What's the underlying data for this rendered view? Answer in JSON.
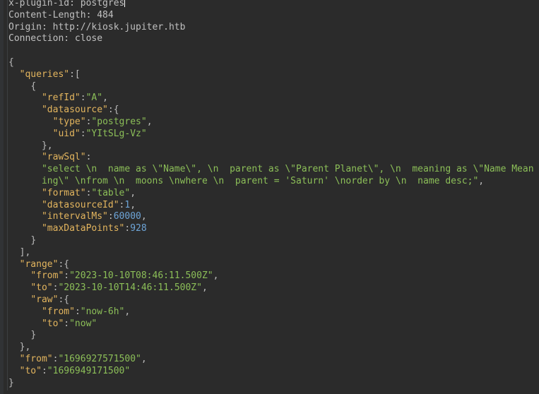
{
  "colors": {
    "background": "#2b2b2b",
    "key": "#e3b55e",
    "string": "#8cbf58",
    "number": "#6ea5d8",
    "text": "#bbbbbb"
  },
  "lines": [
    {
      "indent": 0,
      "tokens": [
        [
          "x-plugin-id: postgres",
          "hdr"
        ]
      ],
      "cursor": true
    },
    {
      "indent": 0,
      "tokens": [
        [
          "Content-Length: 484",
          "hdr"
        ]
      ]
    },
    {
      "indent": 0,
      "tokens": [
        [
          "Origin: http://kiosk.jupiter.htb",
          "hdr"
        ]
      ]
    },
    {
      "indent": 0,
      "tokens": [
        [
          "Connection: close",
          "hdr"
        ]
      ]
    },
    {
      "indent": 0,
      "tokens": []
    },
    {
      "indent": 0,
      "tokens": [
        [
          "{",
          "punc"
        ]
      ]
    },
    {
      "indent": 2,
      "tokens": [
        [
          "\"queries\"",
          "key"
        ],
        [
          ":[",
          "punc"
        ]
      ]
    },
    {
      "indent": 4,
      "tokens": [
        [
          "{",
          "punc"
        ]
      ]
    },
    {
      "indent": 6,
      "tokens": [
        [
          "\"refId\"",
          "key"
        ],
        [
          ":",
          "punc"
        ],
        [
          "\"A\"",
          "str"
        ],
        [
          ",",
          "punc"
        ]
      ]
    },
    {
      "indent": 6,
      "tokens": [
        [
          "\"datasource\"",
          "key"
        ],
        [
          ":{",
          "punc"
        ]
      ]
    },
    {
      "indent": 8,
      "tokens": [
        [
          "\"type\"",
          "key"
        ],
        [
          ":",
          "punc"
        ],
        [
          "\"postgres\"",
          "str"
        ],
        [
          ",",
          "punc"
        ]
      ]
    },
    {
      "indent": 8,
      "tokens": [
        [
          "\"uid\"",
          "key"
        ],
        [
          ":",
          "punc"
        ],
        [
          "\"YItSLg-Vz\"",
          "str"
        ]
      ]
    },
    {
      "indent": 6,
      "tokens": [
        [
          "},",
          "punc"
        ]
      ]
    },
    {
      "indent": 6,
      "tokens": [
        [
          "\"rawSql\"",
          "key"
        ],
        [
          ":",
          "punc"
        ]
      ]
    },
    {
      "indent": 6,
      "tokens": [
        [
          "\"select \\n  name as \\\"Name\\\", \\n  parent as \\\"Parent Planet\\\", \\n  meaning as \\\"Name Meaning\\\" \\nfrom \\n  moons \\nwhere \\n  parent = 'Saturn' \\norder by \\n  name desc;\"",
          "str"
        ],
        [
          ",",
          "punc"
        ]
      ]
    },
    {
      "indent": 6,
      "tokens": [
        [
          "\"format\"",
          "key"
        ],
        [
          ":",
          "punc"
        ],
        [
          "\"table\"",
          "str"
        ],
        [
          ",",
          "punc"
        ]
      ]
    },
    {
      "indent": 6,
      "tokens": [
        [
          "\"datasourceId\"",
          "key"
        ],
        [
          ":",
          "punc"
        ],
        [
          "1",
          "num"
        ],
        [
          ",",
          "punc"
        ]
      ]
    },
    {
      "indent": 6,
      "tokens": [
        [
          "\"intervalMs\"",
          "key"
        ],
        [
          ":",
          "punc"
        ],
        [
          "60000",
          "num"
        ],
        [
          ",",
          "punc"
        ]
      ]
    },
    {
      "indent": 6,
      "tokens": [
        [
          "\"maxDataPoints\"",
          "key"
        ],
        [
          ":",
          "punc"
        ],
        [
          "928",
          "num"
        ]
      ]
    },
    {
      "indent": 4,
      "tokens": [
        [
          "}",
          "punc"
        ]
      ]
    },
    {
      "indent": 2,
      "tokens": [
        [
          "],",
          "punc"
        ]
      ]
    },
    {
      "indent": 2,
      "tokens": [
        [
          "\"range\"",
          "key"
        ],
        [
          ":{",
          "punc"
        ]
      ]
    },
    {
      "indent": 4,
      "tokens": [
        [
          "\"from\"",
          "key"
        ],
        [
          ":",
          "punc"
        ],
        [
          "\"2023-10-10T08:46:11.500Z\"",
          "str"
        ],
        [
          ",",
          "punc"
        ]
      ]
    },
    {
      "indent": 4,
      "tokens": [
        [
          "\"to\"",
          "key"
        ],
        [
          ":",
          "punc"
        ],
        [
          "\"2023-10-10T14:46:11.500Z\"",
          "str"
        ],
        [
          ",",
          "punc"
        ]
      ]
    },
    {
      "indent": 4,
      "tokens": [
        [
          "\"raw\"",
          "key"
        ],
        [
          ":{",
          "punc"
        ]
      ]
    },
    {
      "indent": 6,
      "tokens": [
        [
          "\"from\"",
          "key"
        ],
        [
          ":",
          "punc"
        ],
        [
          "\"now-6h\"",
          "str"
        ],
        [
          ",",
          "punc"
        ]
      ]
    },
    {
      "indent": 6,
      "tokens": [
        [
          "\"to\"",
          "key"
        ],
        [
          ":",
          "punc"
        ],
        [
          "\"now\"",
          "str"
        ]
      ]
    },
    {
      "indent": 4,
      "tokens": [
        [
          "}",
          "punc"
        ]
      ]
    },
    {
      "indent": 2,
      "tokens": [
        [
          "},",
          "punc"
        ]
      ]
    },
    {
      "indent": 2,
      "tokens": [
        [
          "\"from\"",
          "key"
        ],
        [
          ":",
          "punc"
        ],
        [
          "\"1696927571500\"",
          "str"
        ],
        [
          ",",
          "punc"
        ]
      ]
    },
    {
      "indent": 2,
      "tokens": [
        [
          "\"to\"",
          "key"
        ],
        [
          ":",
          "punc"
        ],
        [
          "\"1696949171500\"",
          "str"
        ]
      ]
    },
    {
      "indent": 0,
      "tokens": [
        [
          "}",
          "punc"
        ]
      ]
    }
  ]
}
